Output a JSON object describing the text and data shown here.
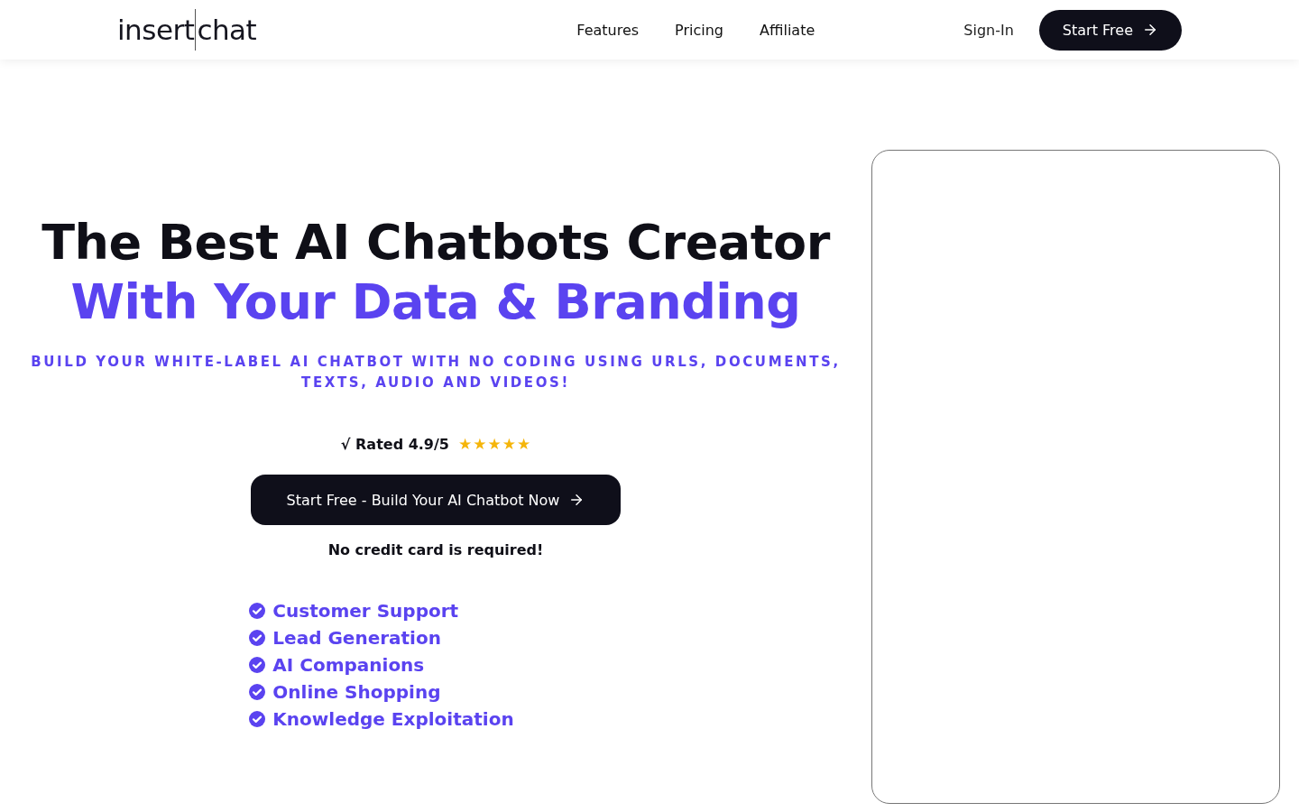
{
  "header": {
    "logo": {
      "before": "insert",
      "after": "chat"
    },
    "nav": [
      "Features",
      "Pricing",
      "Affiliate"
    ],
    "sign_in": "Sign-In",
    "cta": "Start Free"
  },
  "hero": {
    "title": "The Best AI Chatbots Creator",
    "title_accent": "With Your Data & Branding",
    "subtitle": "BUILD YOUR WHITE-LABEL AI CHATBOT WITH NO CODING USING URLS, DOCUMENTS, TEXTS, AUDIO AND VIDEOS!",
    "rating": {
      "text": "√ Rated 4.9/5",
      "stars": 5
    },
    "cta": "Start Free - Build Your AI Chatbot Now",
    "note": "No credit card is required!",
    "use_cases": [
      "Customer Support",
      "Lead Generation",
      "AI Companions",
      "Online Shopping",
      "Knowledge Exploitation"
    ]
  },
  "preview": {
    "kind": "empty"
  }
}
